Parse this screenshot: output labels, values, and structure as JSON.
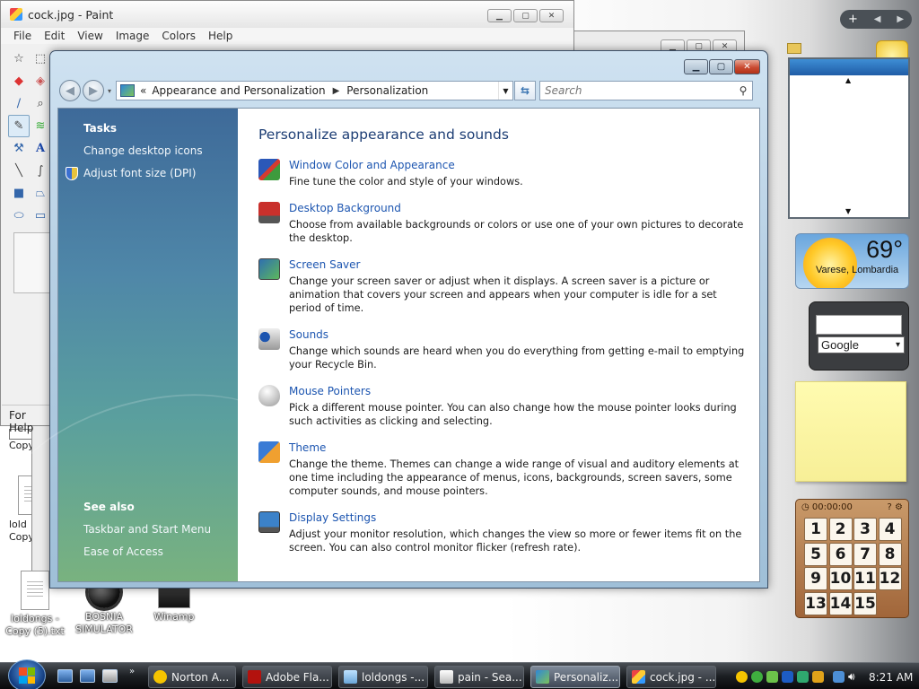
{
  "paint_front": {
    "title": "cock.jpg - Paint",
    "menus": [
      "File",
      "Edit",
      "View",
      "Image",
      "Colors",
      "Help"
    ],
    "status": "For Help"
  },
  "control_panel": {
    "breadcrumb": {
      "overflow": "«",
      "crumbs": [
        "Appearance and Personalization",
        "Personalization"
      ]
    },
    "search_placeholder": "Search",
    "tasks_title": "Tasks",
    "tasks": [
      "Change desktop icons",
      "Adjust font size (DPI)"
    ],
    "see_also_title": "See also",
    "see_also": [
      "Taskbar and Start Menu",
      "Ease of Access"
    ],
    "heading": "Personalize appearance and sounds",
    "items": [
      {
        "title": "Window Color and Appearance",
        "desc": "Fine tune the color and style of your windows."
      },
      {
        "title": "Desktop Background",
        "desc": "Choose from available backgrounds or colors or use one of your own pictures to decorate the desktop."
      },
      {
        "title": "Screen Saver",
        "desc": "Change your screen saver or adjust when it displays. A screen saver is a picture or animation that covers your screen and appears when your computer is idle for a set period of time."
      },
      {
        "title": "Sounds",
        "desc": "Change which sounds are heard when you do everything from getting e-mail to emptying your Recycle Bin."
      },
      {
        "title": "Mouse Pointers",
        "desc": "Pick a different mouse pointer. You can also change how the mouse pointer looks during such activities as clicking and selecting."
      },
      {
        "title": "Theme",
        "desc": "Change the theme. Themes can change a wide range of visual and auditory elements at one time including the appearance of menus, icons, backgrounds, screen savers, some computer sounds, and mouse pointers."
      },
      {
        "title": "Display Settings",
        "desc": "Adjust your monitor resolution, which changes the view so more or fewer items fit on the screen. You can also control monitor flicker (refresh rate)."
      }
    ]
  },
  "desktop_icons": [
    {
      "label": "loldongs - Copy (5).txt"
    },
    {
      "label": "BOSNIA SIMULATOR"
    },
    {
      "label": "Winamp"
    }
  ],
  "desktop_fragments": {
    "copy_a": "Copy",
    "lold": "lold",
    "copy_b": "Copy"
  },
  "gadgets": {
    "weather": {
      "temp": "69°",
      "city": "Varese, Lombardia"
    },
    "search": {
      "engine": "Google"
    },
    "puzzle": {
      "timer": "00:00:00",
      "tiles": [
        "1",
        "2",
        "3",
        "4",
        "5",
        "6",
        "7",
        "8",
        "9",
        "10",
        "11",
        "12",
        "13",
        "14",
        "15",
        ""
      ]
    }
  },
  "taskbar": {
    "buttons": [
      "Norton A...",
      "Adobe Fla...",
      "loldongs -...",
      "pain - Sea...",
      "Personaliz...",
      "cock.jpg - ..."
    ],
    "active_index": 4,
    "clock": "8:21 AM"
  },
  "colors": {
    "link": "#1c55b0",
    "heading": "#1c3d74",
    "sidebar_top": "#3e6a99",
    "sidebar_bottom": "#79b27f"
  }
}
